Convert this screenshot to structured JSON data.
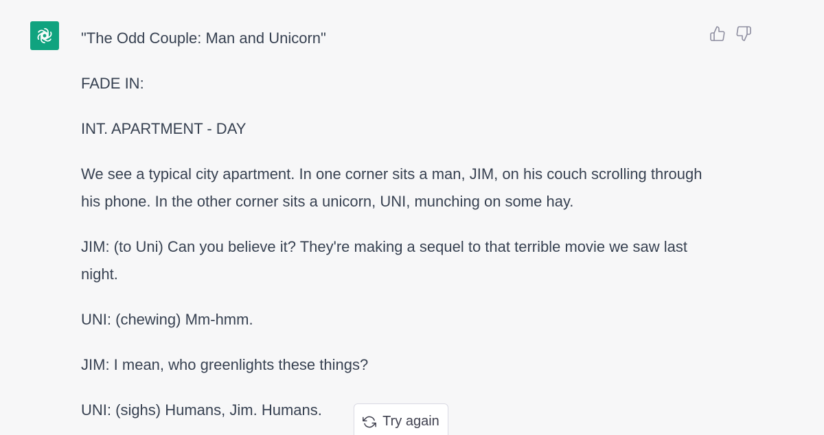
{
  "colors": {
    "brand": "#10a37f",
    "background": "#f7f7f8",
    "text": "#374151",
    "icon": "#8e8ea0"
  },
  "avatar": {
    "icon": "openai-logo-icon"
  },
  "message": {
    "paragraphs": [
      "\"The Odd Couple: Man and Unicorn\"",
      "FADE IN:",
      "INT. APARTMENT - DAY",
      "We see a typical city apartment. In one corner sits a man, JIM, on his couch scrolling through his phone. In the other corner sits a unicorn, UNI, munching on some hay.",
      "JIM: (to Uni) Can you believe it? They're making a sequel to that terrible movie we saw last night.",
      "UNI: (chewing) Mm-hmm.",
      "JIM: I mean, who greenlights these things?",
      "UNI: (sighs) Humans, Jim. Humans."
    ]
  },
  "feedback": {
    "thumbs_up_icon": "thumbs-up-icon",
    "thumbs_down_icon": "thumbs-down-icon"
  },
  "try_again": {
    "label": "Try again",
    "icon": "refresh-icon"
  }
}
